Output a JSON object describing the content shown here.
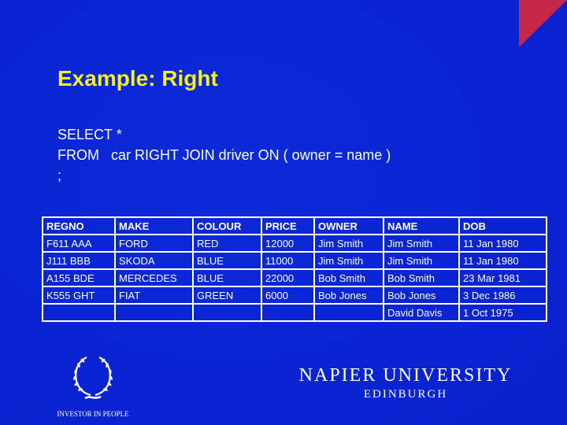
{
  "slide": {
    "title": "Example: Right",
    "accent_triangle_color": "#c4274a",
    "background_color": "#0a25d6",
    "title_color": "#f4f21a"
  },
  "sql": {
    "lines": [
      "SELECT *",
      "FROM   car RIGHT JOIN driver ON ( owner = name )",
      ";"
    ]
  },
  "table": {
    "columns": [
      "REGNO",
      "MAKE",
      "COLOUR",
      "PRICE",
      "OWNER",
      "NAME",
      "DOB"
    ],
    "rows": [
      [
        "F611 AAA",
        "FORD",
        "RED",
        "12000",
        "Jim Smith",
        "Jim Smith",
        "11 Jan 1980"
      ],
      [
        "J111 BBB",
        "SKODA",
        "BLUE",
        "11000",
        "Jim Smith",
        "Jim Smith",
        "11 Jan 1980"
      ],
      [
        "A155 BDE",
        "MERCEDES",
        "BLUE",
        "22000",
        "Bob Smith",
        "Bob Smith",
        "23 Mar 1981"
      ],
      [
        "K555 GHT",
        "FIAT",
        "GREEN",
        "6000",
        "Bob Jones",
        "Bob Jones",
        "3 Dec 1986"
      ],
      [
        "",
        "",
        "",
        "",
        "",
        "David Davis",
        "1 Oct 1975"
      ]
    ]
  },
  "footer": {
    "investor_label": "INVESTOR IN PEOPLE",
    "university_name": "NAPIER UNIVERSITY",
    "university_city": "EDINBURGH"
  }
}
